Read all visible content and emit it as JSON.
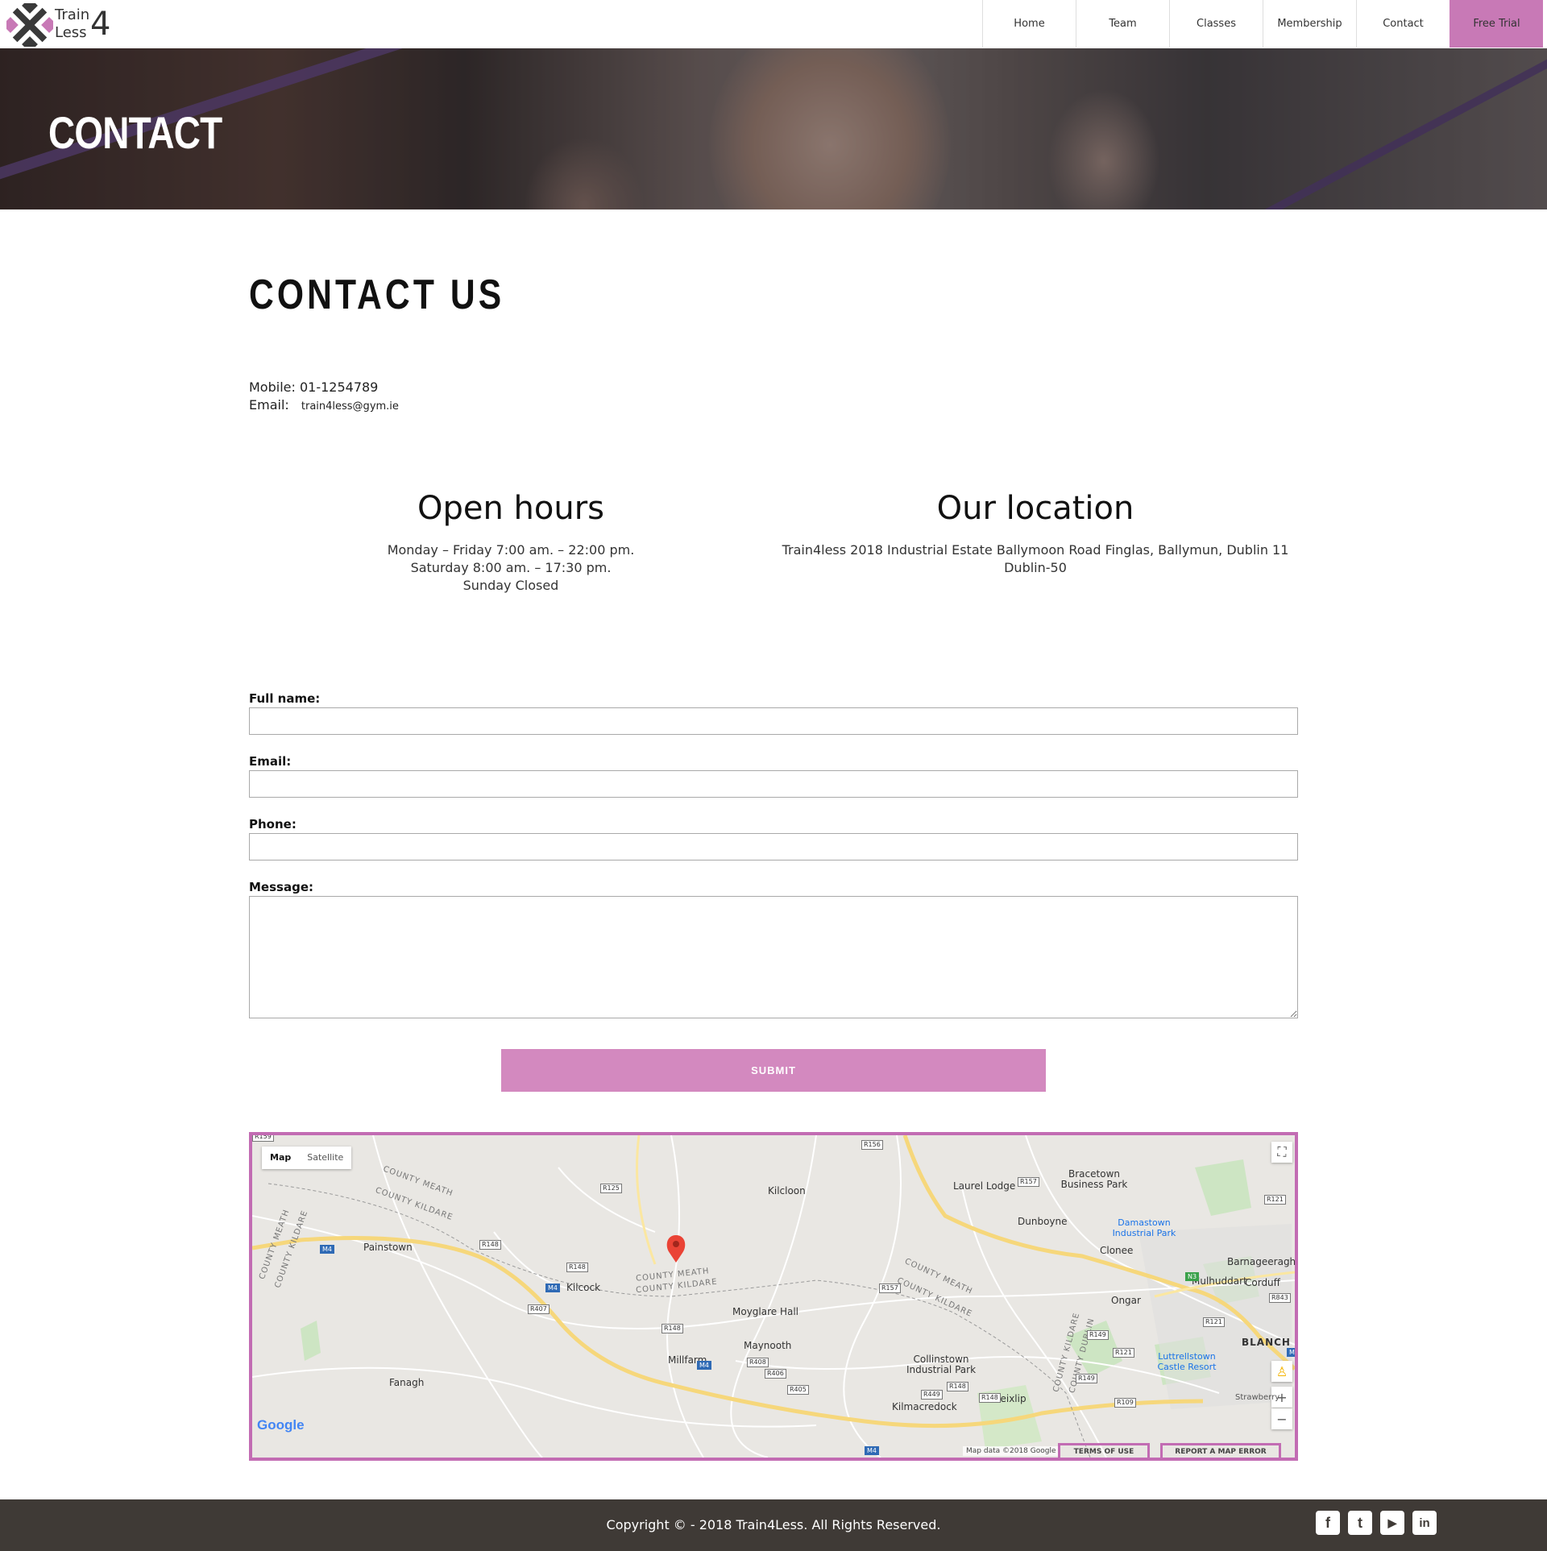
{
  "brand": {
    "line1": "Train",
    "line2": "Less",
    "number": "4"
  },
  "nav": {
    "items": [
      "Home",
      "Team",
      "Classes",
      "Membership",
      "Contact"
    ],
    "cta": "Free Trial",
    "accent": "#c879b6"
  },
  "hero": {
    "title": "CONTACT"
  },
  "main": {
    "heading": "CONTACT US",
    "mobile_label": "Mobile:",
    "mobile_value": "01-1254789",
    "email_label": "Email:",
    "email_value": "train4less@gym.ie"
  },
  "hours": {
    "title": "Open hours",
    "lines": [
      "Monday – Friday 7:00 am. – 22:00 pm.",
      "Saturday 8:00 am. – 17:30 pm.",
      "Sunday Closed"
    ]
  },
  "location": {
    "title": "Our location",
    "lines": [
      "Train4less 2018 Industrial Estate Ballymoon Road Finglas, Ballymun, Dublin 11",
      "Dublin-50"
    ]
  },
  "form": {
    "fullname_label": "Full name:",
    "email_label": "Email:",
    "phone_label": "Phone:",
    "message_label": "Message:",
    "submit_label": "SUBMIT",
    "submit_color": "#d389bf"
  },
  "map": {
    "type_options": [
      "Map",
      "Satellite"
    ],
    "selected_type": "Map",
    "places": [
      "Kilcloon",
      "Laurel Lodge",
      "Bracetown Business Park",
      "Dunboyne",
      "Damastown Industrial Park",
      "Clonee",
      "Barnageeragh",
      "Mulhuddart",
      "Corduff",
      "Ongar",
      "Painstown",
      "Kilcock",
      "Moyglare Hall",
      "Maynooth",
      "Millfarm",
      "Collinstown Industrial Park",
      "Luttrellstown Castle Resort",
      "Fanagh",
      "Leixlip",
      "Kilmacredock",
      "BLANCH",
      "Strawberry"
    ],
    "counties": [
      "COUNTY MEATH",
      "COUNTY KILDARE",
      "COUNTY MEATH",
      "COUNTY KILDARE",
      "COUNTY MEATH",
      "COUNTY KILDARE",
      "COUNTY MEATH",
      "COUNTY KILDARE",
      "COUNTY KILDARE",
      "COUNTY DUBLIN"
    ],
    "roads": [
      "R156",
      "R157",
      "R125",
      "R121",
      "R148",
      "R148",
      "R407",
      "R148",
      "R157",
      "R408",
      "R406",
      "R405",
      "R449",
      "R148",
      "R148",
      "R149",
      "R121",
      "R121",
      "R109",
      "R843",
      "R149",
      "R159"
    ],
    "motorways": [
      "M4",
      "M4",
      "M4",
      "M4",
      "N3",
      "M5"
    ],
    "google_logo": "Google",
    "attribution": "Map data ©2018 Google",
    "terms": "TERMS OF USE",
    "report": "REPORT A MAP ERROR",
    "zoom_in": "+",
    "zoom_out": "−"
  },
  "footer": {
    "copyright": "Copyright © - 2018 Train4Less. All Rights Reserved.",
    "socials": [
      {
        "name": "facebook-icon",
        "glyph": "f"
      },
      {
        "name": "twitter-icon",
        "glyph": "t"
      },
      {
        "name": "youtube-icon",
        "glyph": "▶"
      },
      {
        "name": "linkedin-icon",
        "glyph": "in"
      }
    ]
  }
}
